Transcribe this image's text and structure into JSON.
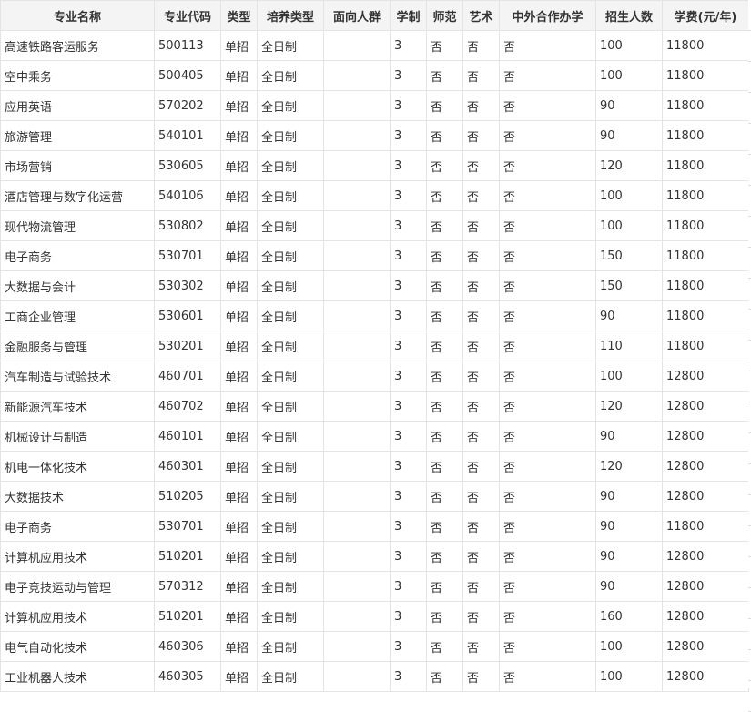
{
  "table": {
    "headers": [
      "专业名称",
      "专业代码",
      "类型",
      "培养类型",
      "面向人群",
      "学制",
      "师范",
      "艺术",
      "中外合作办学",
      "招生人数",
      "学费(元/年)"
    ],
    "rows": [
      [
        "高速铁路客运服务",
        "500113",
        "单招",
        "全日制",
        "",
        "3",
        "否",
        "否",
        "否",
        "100",
        "11800"
      ],
      [
        "空中乘务",
        "500405",
        "单招",
        "全日制",
        "",
        "3",
        "否",
        "否",
        "否",
        "100",
        "11800"
      ],
      [
        "应用英语",
        "570202",
        "单招",
        "全日制",
        "",
        "3",
        "否",
        "否",
        "否",
        "90",
        "11800"
      ],
      [
        "旅游管理",
        "540101",
        "单招",
        "全日制",
        "",
        "3",
        "否",
        "否",
        "否",
        "90",
        "11800"
      ],
      [
        "市场营销",
        "530605",
        "单招",
        "全日制",
        "",
        "3",
        "否",
        "否",
        "否",
        "120",
        "11800"
      ],
      [
        "酒店管理与数字化运营",
        "540106",
        "单招",
        "全日制",
        "",
        "3",
        "否",
        "否",
        "否",
        "100",
        "11800"
      ],
      [
        "现代物流管理",
        "530802",
        "单招",
        "全日制",
        "",
        "3",
        "否",
        "否",
        "否",
        "100",
        "11800"
      ],
      [
        "电子商务",
        "530701",
        "单招",
        "全日制",
        "",
        "3",
        "否",
        "否",
        "否",
        "150",
        "11800"
      ],
      [
        "大数据与会计",
        "530302",
        "单招",
        "全日制",
        "",
        "3",
        "否",
        "否",
        "否",
        "150",
        "11800"
      ],
      [
        "工商企业管理",
        "530601",
        "单招",
        "全日制",
        "",
        "3",
        "否",
        "否",
        "否",
        "90",
        "11800"
      ],
      [
        "金融服务与管理",
        "530201",
        "单招",
        "全日制",
        "",
        "3",
        "否",
        "否",
        "否",
        "110",
        "11800"
      ],
      [
        "汽车制造与试验技术",
        "460701",
        "单招",
        "全日制",
        "",
        "3",
        "否",
        "否",
        "否",
        "100",
        "12800"
      ],
      [
        "新能源汽车技术",
        "460702",
        "单招",
        "全日制",
        "",
        "3",
        "否",
        "否",
        "否",
        "120",
        "12800"
      ],
      [
        "机械设计与制造",
        "460101",
        "单招",
        "全日制",
        "",
        "3",
        "否",
        "否",
        "否",
        "90",
        "12800"
      ],
      [
        "机电一体化技术",
        "460301",
        "单招",
        "全日制",
        "",
        "3",
        "否",
        "否",
        "否",
        "120",
        "12800"
      ],
      [
        "大数据技术",
        "510205",
        "单招",
        "全日制",
        "",
        "3",
        "否",
        "否",
        "否",
        "90",
        "12800"
      ],
      [
        "电子商务",
        "530701",
        "单招",
        "全日制",
        "",
        "3",
        "否",
        "否",
        "否",
        "90",
        "11800"
      ],
      [
        "计算机应用技术",
        "510201",
        "单招",
        "全日制",
        "",
        "3",
        "否",
        "否",
        "否",
        "90",
        "12800"
      ],
      [
        "电子竞技运动与管理",
        "570312",
        "单招",
        "全日制",
        "",
        "3",
        "否",
        "否",
        "否",
        "90",
        "12800"
      ],
      [
        "计算机应用技术",
        "510201",
        "单招",
        "全日制",
        "",
        "3",
        "否",
        "否",
        "否",
        "160",
        "12800"
      ],
      [
        "电气自动化技术",
        "460306",
        "单招",
        "全日制",
        "",
        "3",
        "否",
        "否",
        "否",
        "100",
        "12800"
      ],
      [
        "工业机器人技术",
        "460305",
        "单招",
        "全日制",
        "",
        "3",
        "否",
        "否",
        "否",
        "100",
        "12800"
      ]
    ]
  }
}
